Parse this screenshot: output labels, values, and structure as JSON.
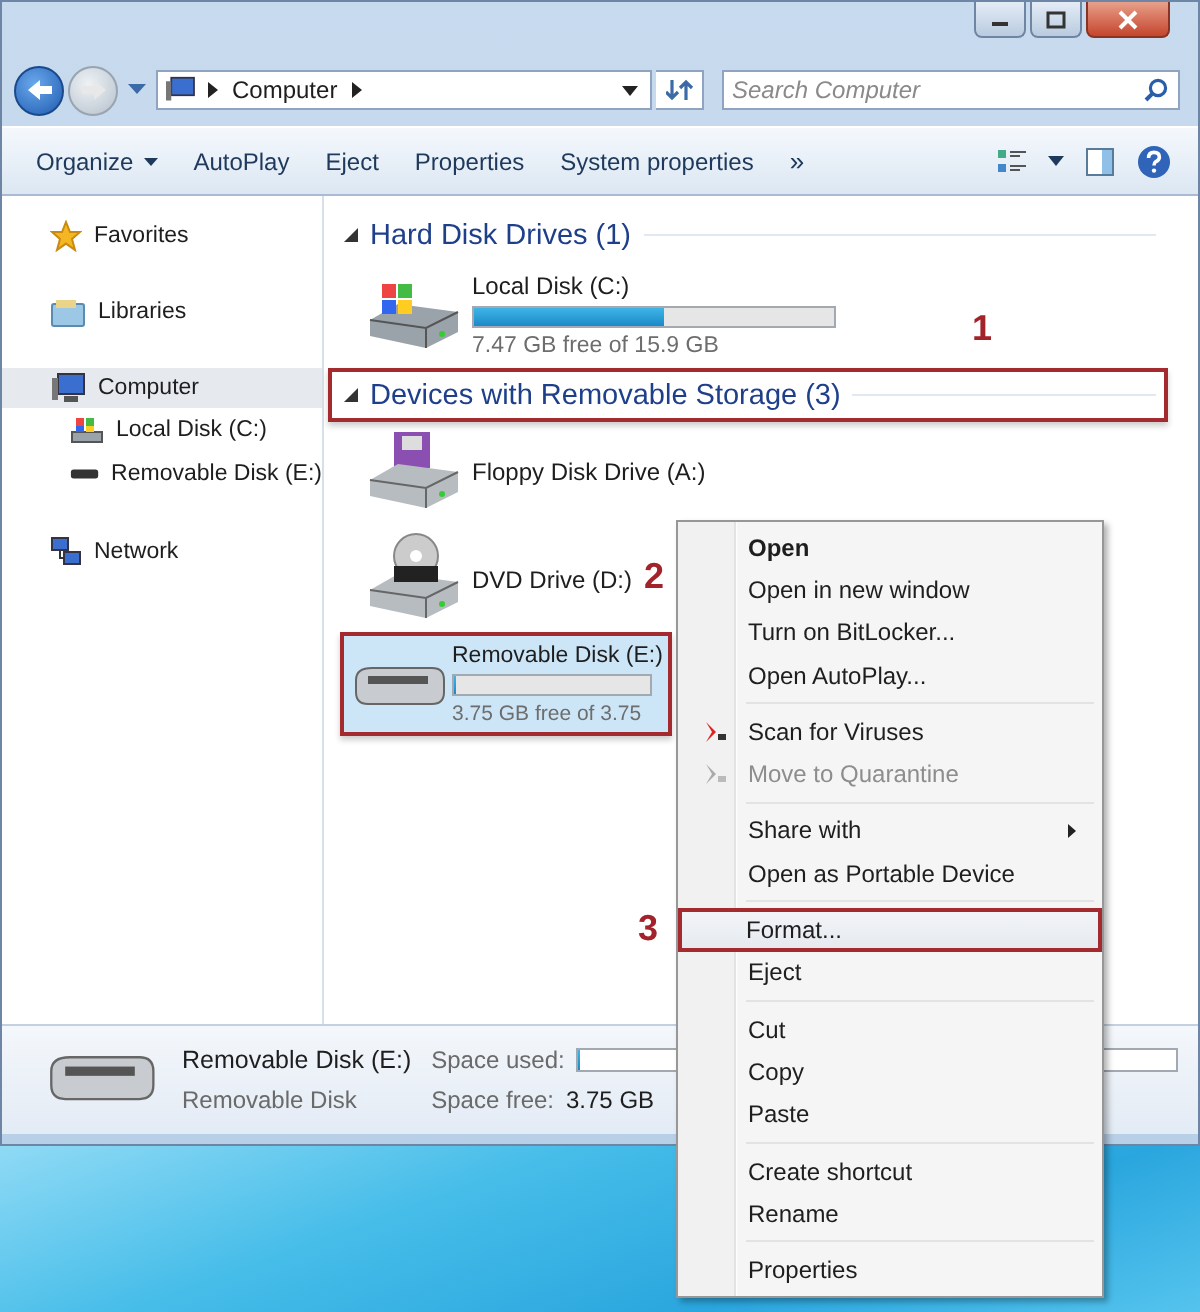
{
  "address": {
    "crumbs": [
      "Computer"
    ]
  },
  "search": {
    "placeholder": "Search Computer"
  },
  "toolbar": [
    {
      "label": "Organize",
      "kind": "menu"
    },
    {
      "label": "AutoPlay",
      "kind": "button"
    },
    {
      "label": "Eject",
      "kind": "button"
    },
    {
      "label": "Properties",
      "kind": "button"
    },
    {
      "label": "System properties",
      "kind": "button"
    },
    {
      "label": "»",
      "kind": "overflow"
    }
  ],
  "sidebar": {
    "items": [
      {
        "label": "Favorites",
        "kind": "star",
        "selected": false
      },
      {
        "label": "Libraries",
        "kind": "library",
        "selected": false
      },
      {
        "label": "Computer",
        "kind": "computer",
        "selected": true,
        "children": [
          {
            "label": "Local Disk (C:)",
            "kind": "hdd",
            "selected": false
          },
          {
            "label": "Removable Disk (E:)",
            "kind": "usb",
            "selected": false
          }
        ]
      },
      {
        "label": "Network",
        "kind": "network",
        "selected": false
      }
    ]
  },
  "groups": [
    {
      "title": "Hard Disk Drives (1)",
      "expanded": true,
      "outlined": false,
      "drives": [
        {
          "name": "Local Disk (C:)",
          "kind": "hdd",
          "selected": false,
          "outlined": false,
          "level": 0.53,
          "reading": "7.47 GB free of 15.9 GB"
        }
      ]
    },
    {
      "title": "Devices with Removable Storage (3)",
      "expanded": true,
      "outlined": true,
      "callout": "1",
      "drives": [
        {
          "name": "Floppy Disk Drive (A:)",
          "kind": "floppy",
          "selected": false,
          "outlined": false
        },
        {
          "name": "DVD Drive (D:)",
          "kind": "dvd",
          "selected": false,
          "outlined": false,
          "callout": "2"
        },
        {
          "name": "Removable Disk (E:)",
          "kind": "usb",
          "selected": true,
          "outlined": true,
          "level": 0,
          "reading": "3.75 GB free of 3.75"
        }
      ]
    }
  ],
  "details": {
    "name": "Removable Disk (E:)",
    "type": "Removable Disk",
    "used_label": "Space used:",
    "level": 0,
    "free_label": "Space free:",
    "free": "3.75 GB"
  },
  "menu": [
    {
      "kind": "item",
      "label": "Open",
      "bold": true,
      "disabled": false,
      "highlighted": false,
      "outlined": false
    },
    {
      "kind": "item",
      "label": "Open in new window",
      "disabled": false,
      "highlighted": false,
      "outlined": false
    },
    {
      "kind": "item",
      "label": "Turn on BitLocker...",
      "disabled": false,
      "highlighted": false,
      "outlined": false
    },
    {
      "kind": "item",
      "label": "Open AutoPlay...",
      "disabled": false,
      "highlighted": false,
      "outlined": false
    },
    {
      "kind": "separator"
    },
    {
      "kind": "icon-item",
      "label": "Scan for Viruses",
      "disabled": false,
      "highlighted": false,
      "outlined": false
    },
    {
      "kind": "icon-item",
      "label": "Move to Quarantine",
      "disabled": true,
      "highlighted": false,
      "outlined": false
    },
    {
      "kind": "separator"
    },
    {
      "kind": "item",
      "label": "Share with",
      "submenu": true,
      "disabled": false,
      "highlighted": false,
      "outlined": false
    },
    {
      "kind": "item",
      "label": "Open as Portable Device",
      "disabled": false,
      "highlighted": false,
      "outlined": false
    },
    {
      "kind": "separator"
    },
    {
      "kind": "item",
      "label": "Format...",
      "disabled": false,
      "highlighted": true,
      "outlined": true,
      "callout": "3"
    },
    {
      "kind": "item",
      "label": "Eject",
      "disabled": false,
      "highlighted": false,
      "outlined": false
    },
    {
      "kind": "separator"
    },
    {
      "kind": "item",
      "label": "Cut",
      "disabled": false,
      "highlighted": false,
      "outlined": false
    },
    {
      "kind": "item",
      "label": "Copy",
      "disabled": false,
      "highlighted": false,
      "outlined": false
    },
    {
      "kind": "item",
      "label": "Paste",
      "disabled": false,
      "highlighted": false,
      "outlined": false
    },
    {
      "kind": "separator"
    },
    {
      "kind": "item",
      "label": "Create shortcut",
      "disabled": false,
      "highlighted": false,
      "outlined": false
    },
    {
      "kind": "item",
      "label": "Rename",
      "disabled": false,
      "highlighted": false,
      "outlined": false
    },
    {
      "kind": "separator"
    },
    {
      "kind": "item",
      "label": "Properties",
      "disabled": false,
      "highlighted": false,
      "outlined": false
    }
  ]
}
